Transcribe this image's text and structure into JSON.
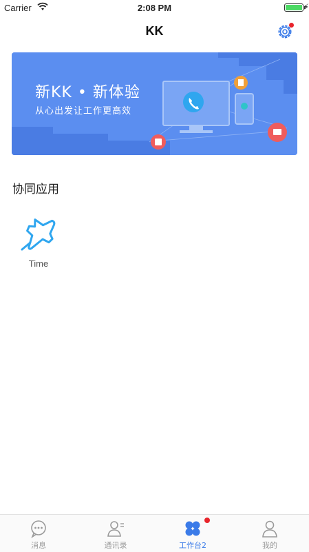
{
  "status": {
    "carrier": "Carrier",
    "time": "2:08 PM"
  },
  "nav": {
    "title": "KK"
  },
  "banner": {
    "title": "新KK • 新体验",
    "subtitle": "从心出发让工作更高效"
  },
  "section": {
    "title": "协同应用"
  },
  "apps": [
    {
      "label": "Time",
      "icon": "pushpin-icon"
    }
  ],
  "tabs": [
    {
      "label": "消息",
      "icon": "chat-icon",
      "active": false
    },
    {
      "label": "通讯录",
      "icon": "contacts-icon",
      "active": false
    },
    {
      "label": "工作台2",
      "icon": "workbench-icon",
      "active": true,
      "badge": true
    },
    {
      "label": "我的",
      "icon": "profile-icon",
      "active": false
    }
  ],
  "colors": {
    "accent": "#3b7be8",
    "banner": "#5b8ef0",
    "badge": "#e8242b",
    "inactive": "#9a9a9a"
  }
}
